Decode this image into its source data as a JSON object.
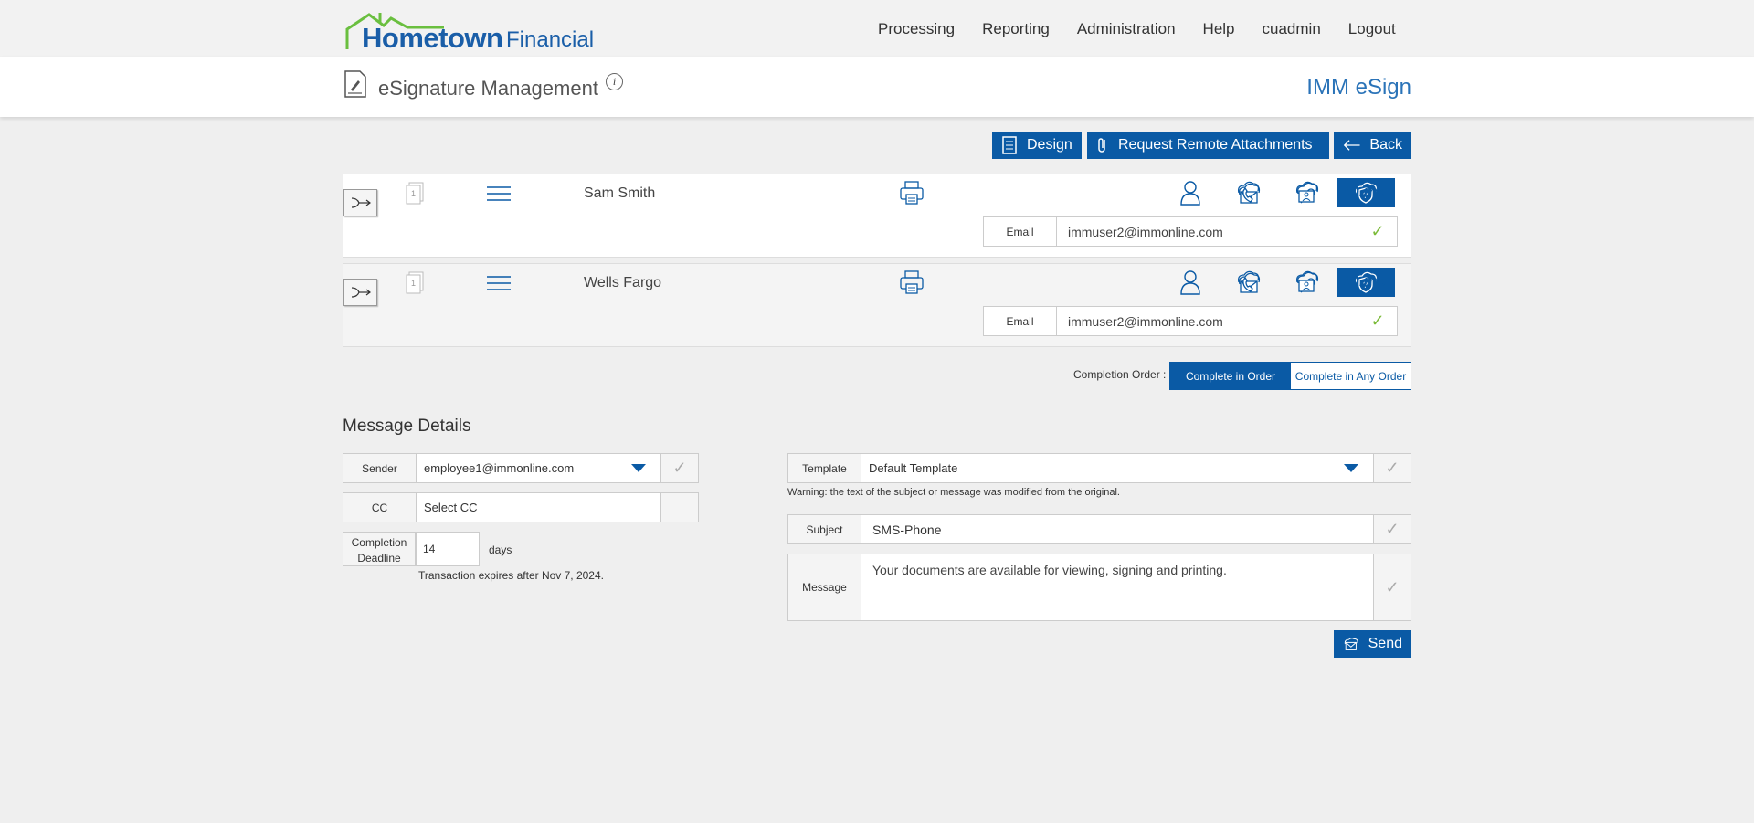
{
  "brand": {
    "name_part1": "Hometown",
    "name_part2": "Financial"
  },
  "nav": [
    "Processing",
    "Reporting",
    "Administration",
    "Help",
    "cuadmin",
    "Logout"
  ],
  "header": {
    "title": "eSignature Management",
    "info": "i",
    "app_name": "IMM eSign"
  },
  "actions": {
    "design": "Design",
    "attachments": "Request Remote Attachments",
    "back": "Back"
  },
  "signers": [
    {
      "name": "Sam Smith",
      "doc_num": "1",
      "email_label": "Email",
      "email": "immuser2@immonline.com",
      "idme": "ID.me"
    },
    {
      "name": "Wells Fargo",
      "doc_num": "1",
      "email_label": "Email",
      "email": "immuser2@immonline.com",
      "idme": "ID.me"
    }
  ],
  "completion_order": {
    "label": "Completion Order :",
    "in_order": "Complete in Order",
    "any_order": "Complete in Any Order",
    "selected": "Complete in Order"
  },
  "message_details": {
    "title": "Message Details",
    "sender_label": "Sender",
    "sender_value": "employee1@immonline.com",
    "cc_label": "CC",
    "cc_placeholder": "Select CC",
    "deadline_label": "Completion Deadline",
    "deadline_value": "14",
    "deadline_unit": "days",
    "expires": "Transaction expires after Nov 7, 2024.",
    "template_label": "Template",
    "template_value": "Default Template",
    "warning": "Warning: the text of the subject or message was modified from the original.",
    "subject_label": "Subject",
    "subject_value": "SMS-Phone",
    "message_label": "Message",
    "message_value": "Your documents are available for viewing, signing and printing.",
    "send": "Send"
  },
  "colors": {
    "primary": "#0a5aa5",
    "accent_green": "#7cbb3a",
    "brand_green": "#6abf3f"
  }
}
